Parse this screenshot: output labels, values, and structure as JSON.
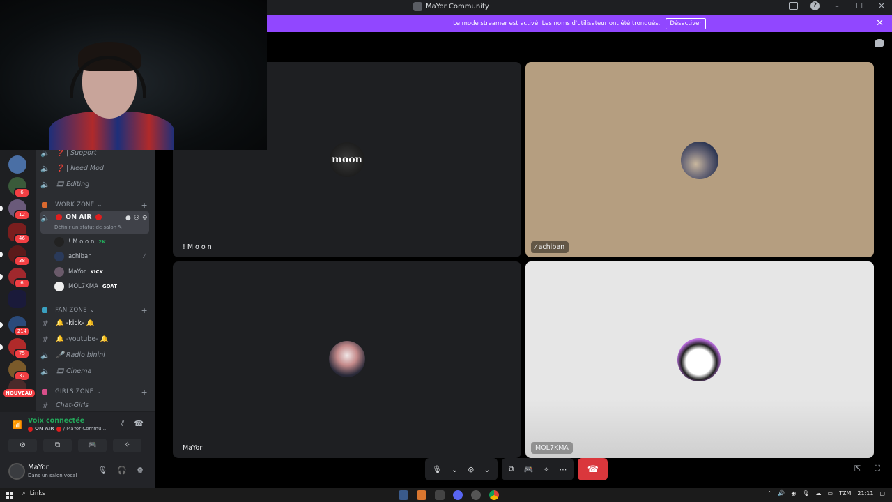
{
  "window": {
    "title": "MaYor Community"
  },
  "banner": {
    "text": "Le mode streamer est activé. Les noms d'utilisateur ont été tronqués.",
    "button": "Désactiver"
  },
  "channels": {
    "top_items": [
      {
        "icon": "speaker-icon",
        "label": "❓ | Support"
      },
      {
        "icon": "speaker-icon",
        "label": "❓ | Need Mod"
      },
      {
        "icon": "speaker-icon",
        "label": "🎞 Editing"
      }
    ],
    "work_zone": {
      "category": "| WORK ZONE",
      "active_channel": "ON AIR",
      "status_hint": "Définir un statut de salon",
      "users": [
        {
          "name": "! M o o n",
          "tag": "2K"
        },
        {
          "name": "achiban",
          "tag": ""
        },
        {
          "name": "MaYor",
          "tag": "KICK"
        },
        {
          "name": "MOL7KMA",
          "tag": "GOAT"
        }
      ]
    },
    "fan_zone": {
      "category": "| FAN ZONE",
      "items": [
        {
          "icon": "#",
          "label": "🔔 -kick- 🔔"
        },
        {
          "icon": "#",
          "label": "🔔 -youtube- 🔔"
        },
        {
          "icon": "speaker-icon",
          "label": "🎤 Radio binini"
        },
        {
          "icon": "speaker-icon",
          "label": "🎞 Cinema"
        }
      ]
    },
    "girls_zone": {
      "category": "| GIRLS ZONE",
      "items": [
        {
          "icon": "#",
          "label": "Chat-Girls"
        }
      ]
    }
  },
  "servers": {
    "badges": [
      "6",
      "12",
      "46",
      "38",
      "6",
      "214",
      "75",
      "37"
    ],
    "new_label": "NOUVEAU"
  },
  "voice": {
    "status": "Voix connectée",
    "channel": "ON AIR",
    "server": "/ MaYor Commu..."
  },
  "user": {
    "name": "MaYor",
    "status": "Dans un salon vocal"
  },
  "tiles": [
    {
      "name": "! M o o n",
      "avatar_text": "moon",
      "bg": "#1e1f22"
    },
    {
      "name": "achiban",
      "bg": "#b59e80"
    },
    {
      "name": "MaYor",
      "bg": "#1e1f22"
    },
    {
      "name": "MOL7KMA",
      "bg": "#e8e8e8"
    }
  ],
  "taskbar": {
    "search": "Links",
    "time": "21:11",
    "lang": "TZM"
  },
  "colors": {
    "banner": "#9147ff",
    "hangup": "#da373c",
    "voice_green": "#23a559",
    "badge_red": "#f23f43"
  }
}
